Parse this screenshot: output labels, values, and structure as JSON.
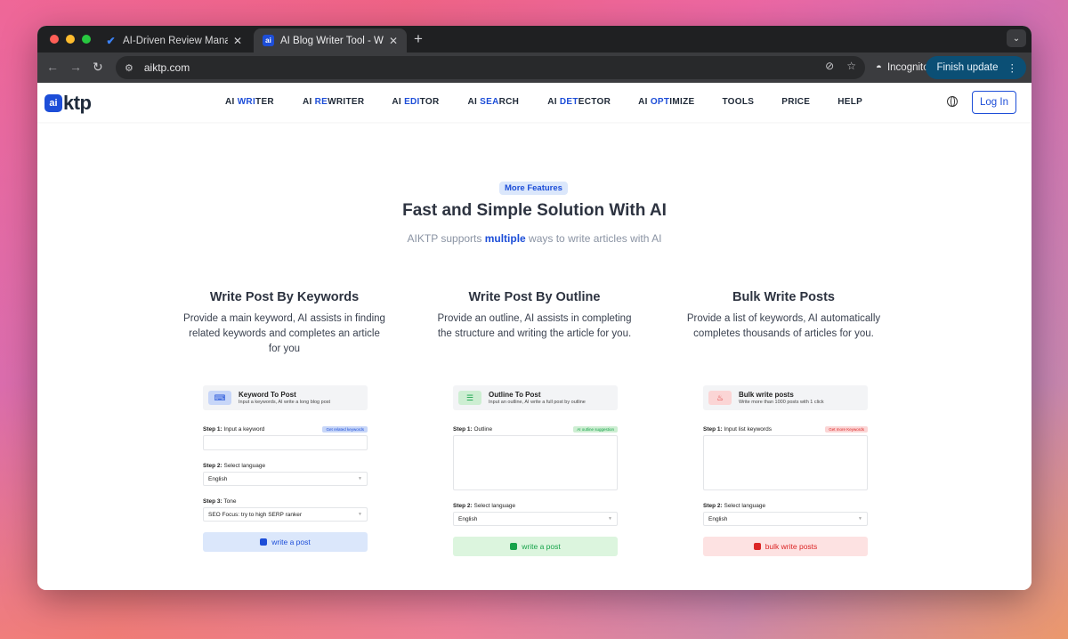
{
  "browser": {
    "tabs": [
      {
        "title": "AI-Driven Review Managemen",
        "favicon": "check-icon"
      },
      {
        "title": "AI Blog Writer Tool - Write Co",
        "favicon": "ai"
      }
    ],
    "new_tab": "+",
    "url": "aiktp.com",
    "incognito_label": "Incognito",
    "finish_update_label": "Finish update"
  },
  "site": {
    "logo_mark": "ai",
    "logo_word": "ktp",
    "menu": [
      {
        "prefix": "AI ",
        "highlight": "WRI",
        "suffix": "TER"
      },
      {
        "prefix": "AI ",
        "highlight": "RE",
        "suffix": "WRITER"
      },
      {
        "prefix": "AI ",
        "highlight": "EDI",
        "suffix": "TOR"
      },
      {
        "prefix": "AI ",
        "highlight": "SEA",
        "suffix": "RCH"
      },
      {
        "prefix": "AI ",
        "highlight": "DET",
        "suffix": "ECTOR"
      },
      {
        "prefix": "AI ",
        "highlight": "OPT",
        "suffix": "IMIZE"
      },
      {
        "prefix": "TOOLS",
        "highlight": "",
        "suffix": ""
      },
      {
        "prefix": "PRICE",
        "highlight": "",
        "suffix": ""
      },
      {
        "prefix": "HELP",
        "highlight": "",
        "suffix": ""
      }
    ],
    "login_label": "Log In"
  },
  "hero": {
    "pill": "More Features",
    "title": "Fast and Simple Solution With AI",
    "sub_before": "AIKTP supports ",
    "sub_highlight": "multiple",
    "sub_after": " ways to write articles with AI"
  },
  "columns": [
    {
      "title": "Write Post By Keywords",
      "desc": "Provide a main keyword, AI assists in finding related keywords and completes an article for you",
      "card": {
        "head_title": "Keyword To Post",
        "head_sub": "Input a keywords, AI write a long blog post",
        "step1_label": "Step 1:",
        "step1_text": "Input a keyword",
        "step1_tag": "Get related keywords",
        "step2_label": "Step 2:",
        "step2_text": "Select language",
        "language": "English",
        "step3_label": "Step 3:",
        "step3_text": "Tone",
        "tone": "SEO Focus: try to high SERP ranker",
        "button": "write a post"
      }
    },
    {
      "title": "Write Post By Outline",
      "desc": "Provide an outline, AI assists in completing the structure and writing the article for you.",
      "card": {
        "head_title": "Outline To Post",
        "head_sub": "Input an outline, AI write a full post by outline",
        "step1_label": "Step 1:",
        "step1_text": "Outline",
        "step1_tag": "AI outline suggestion",
        "step2_label": "Step 2:",
        "step2_text": "Select language",
        "language": "English",
        "button": "write a post"
      }
    },
    {
      "title": "Bulk Write Posts",
      "desc": "Provide a list of keywords, AI automatically completes thousands of articles for you.",
      "card": {
        "head_title": "Bulk write posts",
        "head_sub": "Write more than 1000 posts with 1 click",
        "step1_label": "Step 1:",
        "step1_text": "Input list keywords",
        "step1_tag": "Get more Keywords",
        "step2_label": "Step 2:",
        "step2_text": "Select language",
        "language": "English",
        "button": "bulk write posts"
      }
    }
  ],
  "colors": {
    "brand": "#1d4ed8",
    "blue_soft": "#dbe7fb",
    "green": "#16a34a",
    "green_soft": "#dcf5de",
    "red": "#dc2626",
    "red_soft": "#fde2e2"
  }
}
